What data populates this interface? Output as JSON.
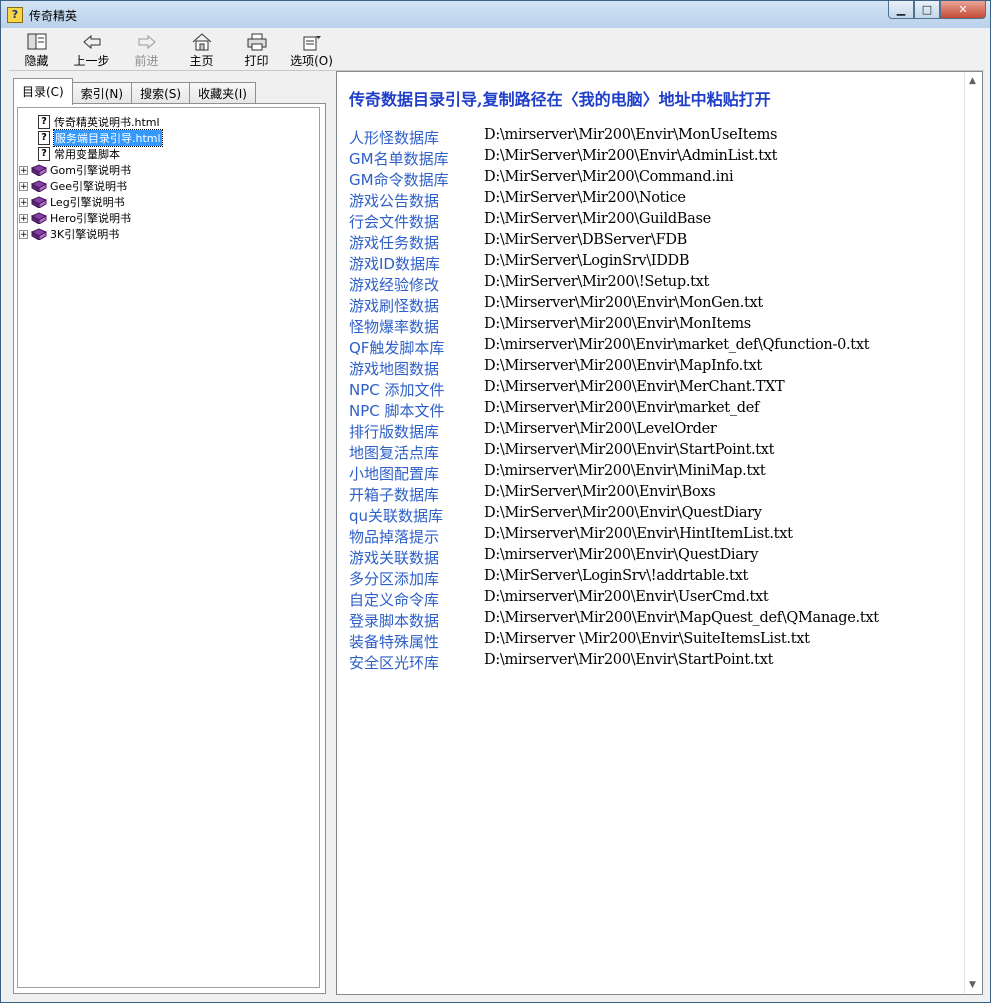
{
  "window": {
    "title": "传奇精英",
    "btn_min": "▁",
    "btn_max": "□",
    "btn_close": "✕"
  },
  "toolbar": [
    {
      "label": "隐藏",
      "icon": "hide-icon",
      "enabled": true
    },
    {
      "label": "上一步",
      "icon": "back-arrow-icon",
      "enabled": true
    },
    {
      "label": "前进",
      "icon": "forward-arrow-icon",
      "enabled": false
    },
    {
      "label": "主页",
      "icon": "home-icon",
      "enabled": true
    },
    {
      "label": "打印",
      "icon": "printer-icon",
      "enabled": true
    },
    {
      "label": "选项(O)",
      "icon": "options-icon",
      "enabled": true
    }
  ],
  "tabs": [
    {
      "label": "目录(C)",
      "active": true
    },
    {
      "label": "索引(N)",
      "active": false
    },
    {
      "label": "搜索(S)",
      "active": false
    },
    {
      "label": "收藏夹(I)",
      "active": false
    }
  ],
  "tree": [
    {
      "label": "传奇精英说明书.html",
      "type": "page",
      "selected": false
    },
    {
      "label": "服务端目录引导.html",
      "type": "page",
      "selected": true
    },
    {
      "label": "常用变量脚本",
      "type": "page",
      "selected": false
    },
    {
      "label": "Gom引擎说明书",
      "type": "book",
      "expander": "+"
    },
    {
      "label": "Gee引擎说明书",
      "type": "book",
      "expander": "+"
    },
    {
      "label": "Leg引擎说明书",
      "type": "book",
      "expander": "+"
    },
    {
      "label": "Hero引擎说明书",
      "type": "book",
      "expander": "+"
    },
    {
      "label": "3K引擎说明书",
      "type": "book",
      "expander": "+"
    }
  ],
  "content": {
    "heading": "传奇数据目录引导,复制路径在〈我的电脑〉地址中粘贴打开",
    "rows": [
      {
        "name": "人形怪数据库",
        "path": "D:\\mirserver\\Mir200\\Envir\\MonUseItems"
      },
      {
        "name": "GM名单数据库",
        "path": "D:\\MirServer\\Mir200\\Envir\\AdminList.txt"
      },
      {
        "name": "GM命令数据库",
        "path": "D:\\MirServer\\Mir200\\Command.ini"
      },
      {
        "name": "游戏公告数据",
        "path": "D:\\MirServer\\Mir200\\Notice"
      },
      {
        "name": "行会文件数据",
        "path": "D:\\MirServer\\Mir200\\GuildBase"
      },
      {
        "name": "游戏任务数据",
        "path": "D:\\MirServer\\DBServer\\FDB"
      },
      {
        "name": "游戏ID数据库",
        "path": "D:\\MirServer\\LoginSrv\\IDDB"
      },
      {
        "name": "游戏经验修改",
        "path": "D:\\MirServer\\Mir200\\!Setup.txt"
      },
      {
        "name": "游戏刷怪数据",
        "path": "D:\\Mirserver\\Mir200\\Envir\\MonGen.txt"
      },
      {
        "name": "怪物爆率数据",
        "path": "D:\\Mirserver\\Mir200\\Envir\\MonItems"
      },
      {
        "name": "QF触发脚本库",
        "path": "D:\\mirserver\\Mir200\\Envir\\market_def\\Qfunction-0.txt"
      },
      {
        "name": "游戏地图数据",
        "path": "D:\\Mirserver\\Mir200\\Envir\\MapInfo.txt"
      },
      {
        "name": "NPC 添加文件",
        "path": "D:\\Mirserver\\Mir200\\Envir\\MerChant.TXT"
      },
      {
        "name": "NPC 脚本文件",
        "path": "D:\\Mirserver\\Mir200\\Envir\\market_def"
      },
      {
        "name": "排行版数据库",
        "path": "D:\\Mirserver\\Mir200\\LevelOrder"
      },
      {
        "name": "地图复活点库",
        "path": "D:\\Mirserver\\Mir200\\Envir\\StartPoint.txt"
      },
      {
        "name": "小地图配置库",
        "path": "D:\\mirserver\\Mir200\\Envir\\MiniMap.txt"
      },
      {
        "name": "开箱子数据库",
        "path": "D:\\MirServer\\Mir200\\Envir\\Boxs"
      },
      {
        "name": "qu关联数据库",
        "path": "D:\\MirServer\\Mir200\\Envir\\QuestDiary"
      },
      {
        "name": "物品掉落提示",
        "path": "D:\\Mirserver\\Mir200\\Envir\\HintItemList.txt"
      },
      {
        "name": "游戏关联数据",
        "path": "D:\\mirserver\\Mir200\\Envir\\QuestDiary"
      },
      {
        "name": "多分区添加库",
        "path": "D:\\MirServer\\LoginSrv\\!addrtable.txt"
      },
      {
        "name": "自定义命令库",
        "path": "D:\\mirserver\\Mir200\\Envir\\UserCmd.txt"
      },
      {
        "name": "登录脚本数据",
        "path": "D:\\Mirserver\\Mir200\\Envir\\MapQuest_def\\QManage.txt"
      },
      {
        "name": "装备特殊属性",
        "path": "D:\\Mirserver \\Mir200\\Envir\\SuiteItemsList.txt"
      },
      {
        "name": "安全区光环库",
        "path": "D:\\mirserver\\Mir200\\Envir\\StartPoint.txt"
      }
    ]
  },
  "colors": {
    "link": "#2e60c8",
    "heading": "#1f3fc8",
    "selection": "#3399ff"
  }
}
